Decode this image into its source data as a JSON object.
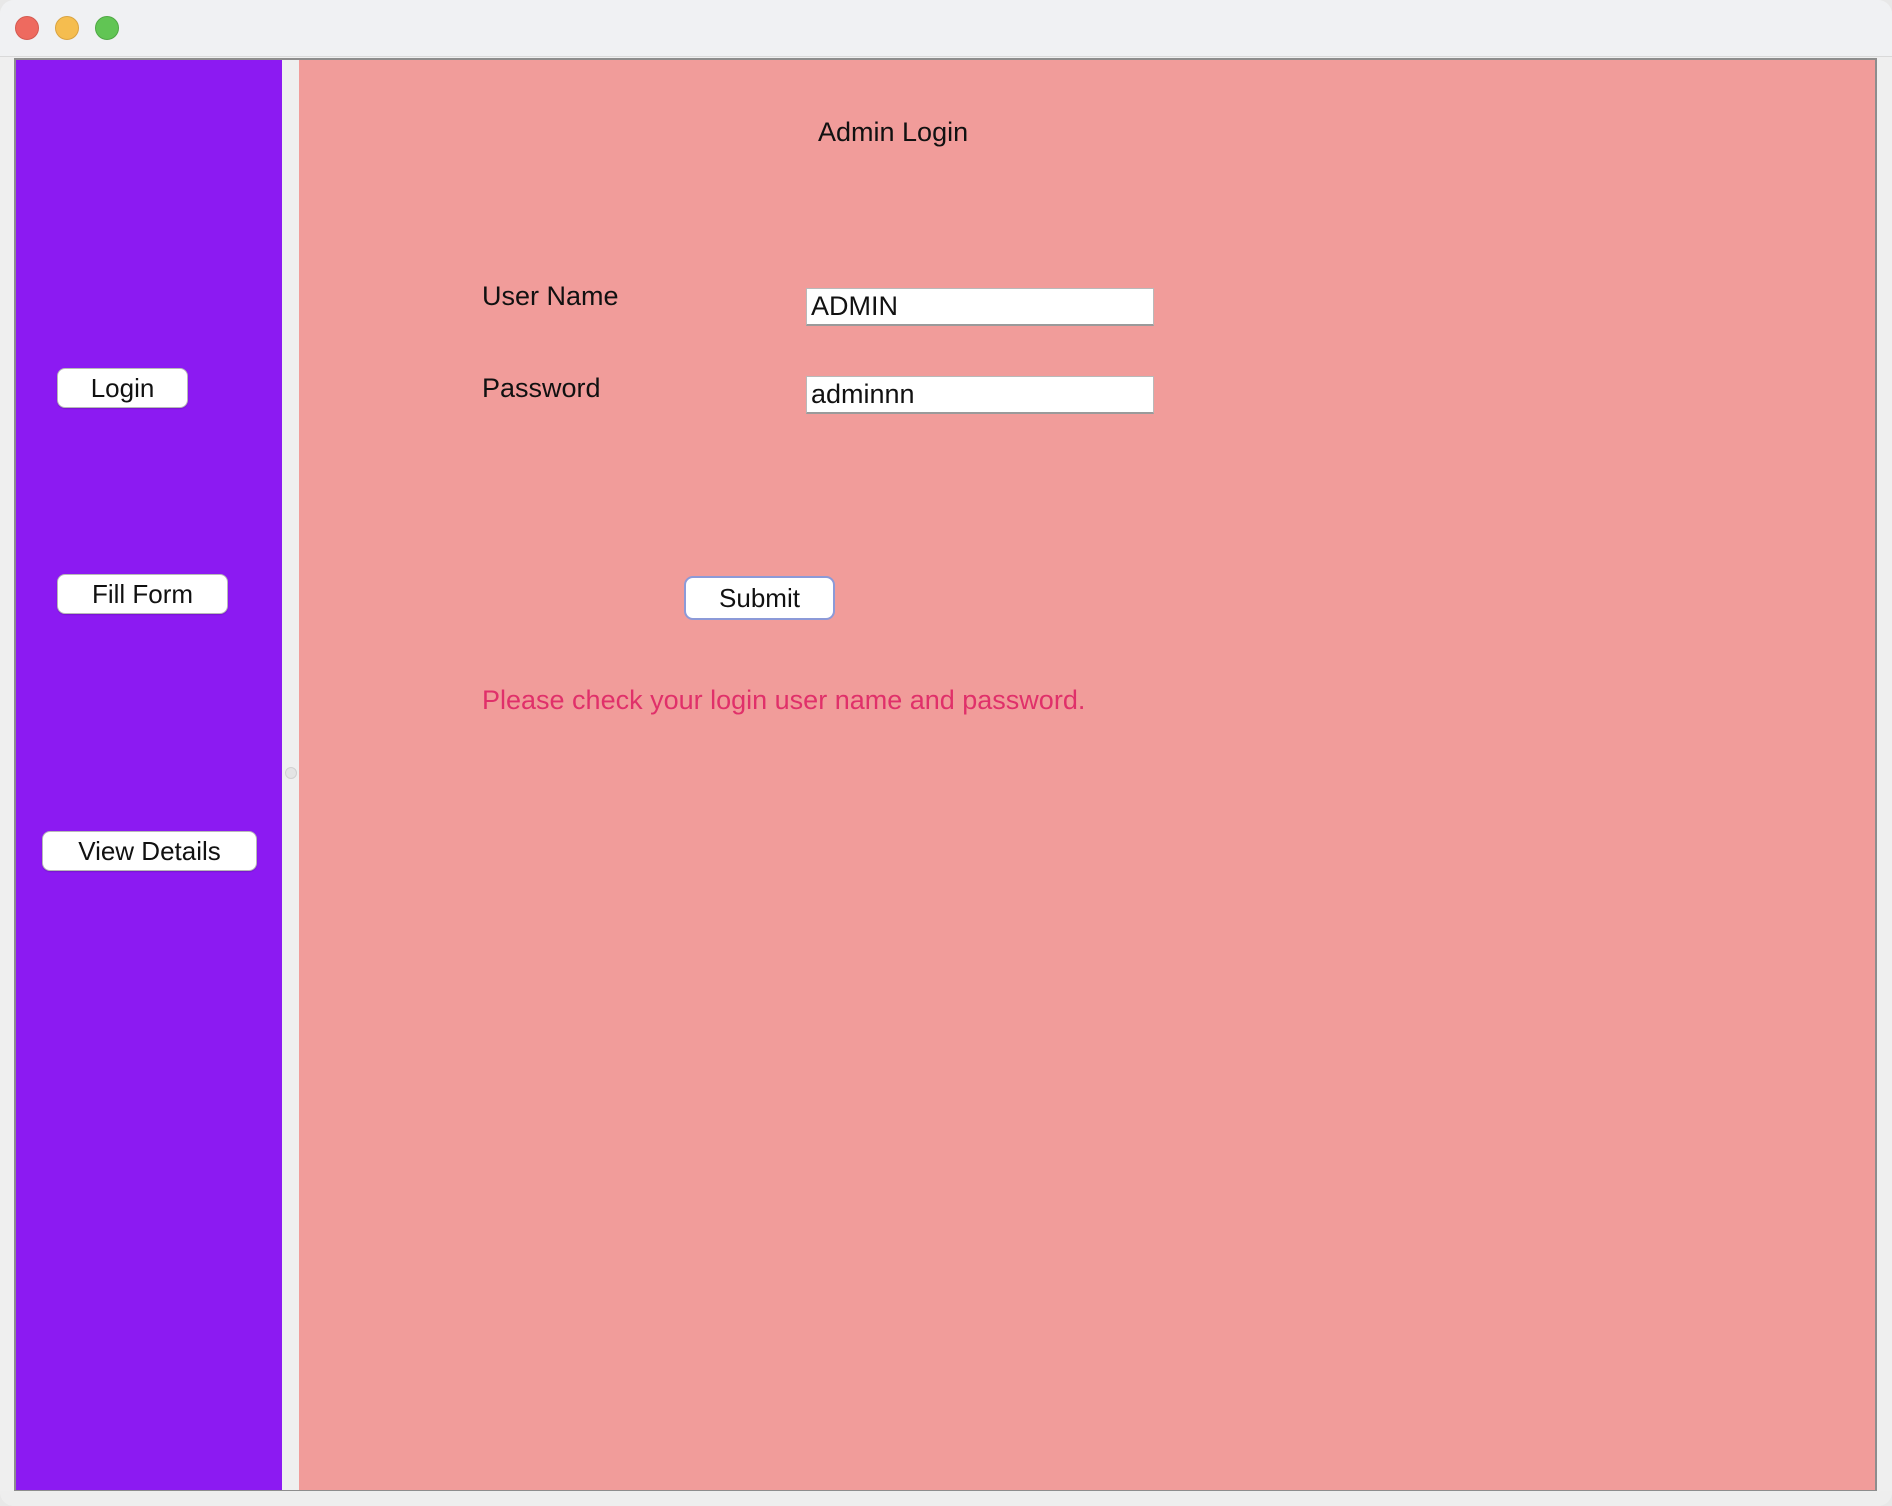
{
  "window": {
    "controls": [
      "close",
      "minimize",
      "zoom"
    ]
  },
  "sidebar": {
    "background": "#8c1af2",
    "buttons": {
      "login": "Login",
      "fill_form": "Fill Form",
      "view_details": "View Details"
    }
  },
  "main": {
    "background": "#f19c9a",
    "title": "Admin Login",
    "username_label": "User Name",
    "username_value": "ADMIN",
    "password_label": "Password",
    "password_value": "adminnn",
    "submit_label": "Submit",
    "error_message": "Please check your login user name and password.",
    "error_color": "#e0306a"
  }
}
